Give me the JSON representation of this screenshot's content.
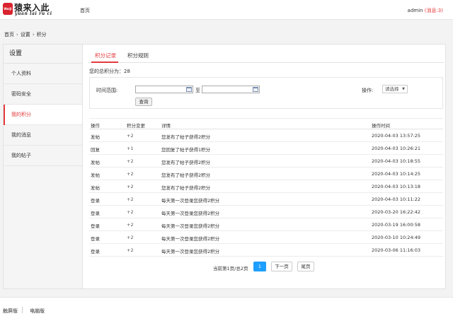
{
  "header": {
    "logo_cn": "猿来入此",
    "logo_en": "yuan lai ru ci",
    "logo_badge": "WeiJi",
    "nav_home": "首页",
    "user": "admin",
    "message": "(消息:3)"
  },
  "breadcrumb": [
    "首页",
    "设置",
    "积分"
  ],
  "sidebar": {
    "title": "设置",
    "items": [
      {
        "label": "个人资料"
      },
      {
        "label": "密码安全"
      },
      {
        "label": "我的积分"
      },
      {
        "label": "我的消息"
      },
      {
        "label": "我的帖子"
      }
    ]
  },
  "tabs": [
    "积分记录",
    "积分规则"
  ],
  "total_text": "您的总积分为：28",
  "filter": {
    "time_label": "时间范围:",
    "to_label": "至",
    "op_label": "操作:",
    "select_value": "请选择",
    "query_label": "查询"
  },
  "table": {
    "headers": [
      "操作",
      "积分变更",
      "详情",
      "操作时间"
    ],
    "rows": [
      [
        "发帖",
        "+2",
        "您发布了帖子获得2积分",
        "2020-04-03 13:57:25"
      ],
      [
        "回复",
        "+1",
        "您回复了帖子获得1积分",
        "2020-04-03 10:26:21"
      ],
      [
        "发帖",
        "+2",
        "您发布了帖子获得2积分",
        "2020-04-03 10:18:55"
      ],
      [
        "发帖",
        "+2",
        "您发布了帖子获得2积分",
        "2020-04-03 10:14:25"
      ],
      [
        "发帖",
        "+2",
        "您发布了帖子获得2积分",
        "2020-04-03 10:13:18"
      ],
      [
        "登录",
        "+2",
        "每天第一次登录您获得2积分",
        "2020-04-03 10:11:22"
      ],
      [
        "登录",
        "+2",
        "每天第一次登录您获得2积分",
        "2020-03-20 16:22:42"
      ],
      [
        "登录",
        "+2",
        "每天第一次登录您获得2积分",
        "2020-03-19 16:00:58"
      ],
      [
        "登录",
        "+2",
        "每天第一次登录您获得2积分",
        "2020-03-10 10:24:49"
      ],
      [
        "登录",
        "+2",
        "每天第一次登录您获得2积分",
        "2020-03-06 11:16:03"
      ]
    ]
  },
  "pager": {
    "info": "当前第1页/总2页",
    "current": "1",
    "next": "下一页",
    "last": "尾页"
  },
  "footer": {
    "touch": "触屏版",
    "desktop": "电脑版"
  },
  "colors": {
    "accent": "#e4393c",
    "page_active": "#1e9fff"
  }
}
